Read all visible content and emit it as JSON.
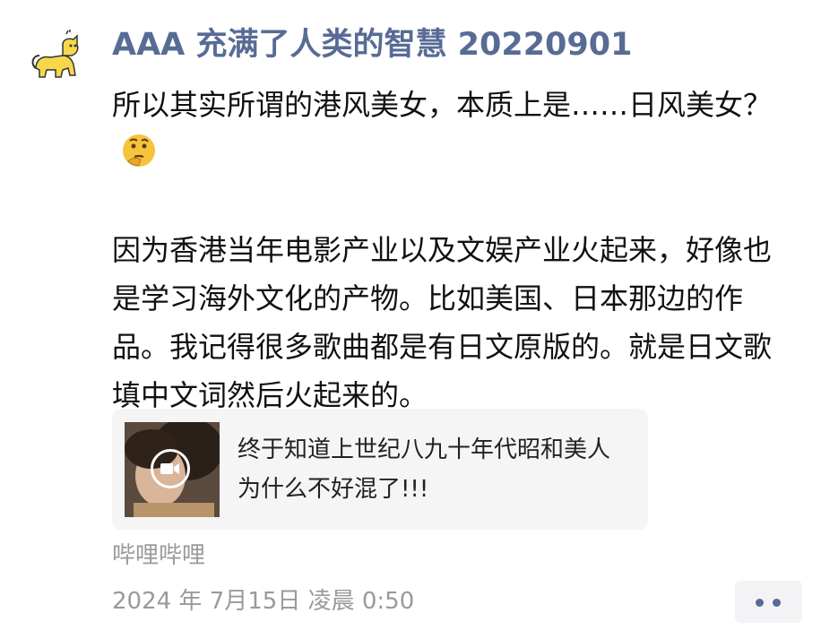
{
  "post": {
    "username": "AAA 充满了人类的智慧 20220901",
    "avatar_icon": "yellow-cat-icon",
    "text_line1": "所以其实所谓的港风美女，本质上是……日风美女？",
    "emoji_icon": "thinking-face-emoji",
    "text_para2": "因为香港当年电影产业以及文娱产业火起来，好像也是学习海外文化的产物。比如美国、日本那边的作品。我记得很多歌曲都是有日文原版的。就是日文歌填中文词然后火起来的。"
  },
  "share_card": {
    "thumbnail_icon": "video-thumbnail",
    "play_icon": "video-camera-icon",
    "title": "终于知道上世纪八九十年代昭和美人为什么不好混了!!!"
  },
  "meta": {
    "source": "哔哩哔哩",
    "time": "2024 年 7月15日 凌晨 0:50"
  },
  "actions": {
    "more_icon": "more-dots-icon"
  },
  "colors": {
    "username": "#576b95",
    "meta_text": "#9a9a9a",
    "card_bg": "#f5f5f5"
  }
}
